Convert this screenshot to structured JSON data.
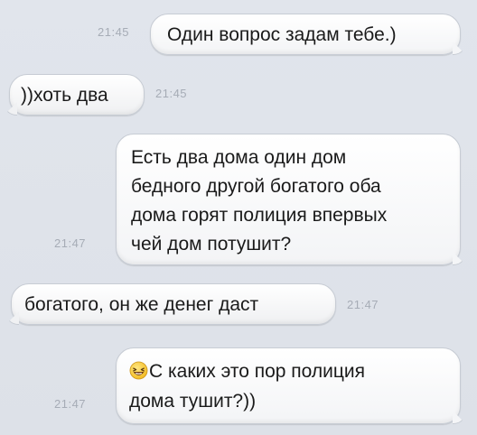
{
  "messages": [
    {
      "side": "out",
      "text": "Один вопрос задам тебе.)",
      "time": "21:45"
    },
    {
      "side": "in",
      "text": "))хоть два",
      "time": "21:45"
    },
    {
      "side": "out",
      "lines": [
        "Есть два дома один дом",
        "бедного другой богатого оба",
        "дома горят полиция впервых",
        "чей дом потушит?"
      ],
      "time": "21:47"
    },
    {
      "side": "in",
      "text": "богатого, он же денег даст",
      "time": "21:47"
    },
    {
      "side": "out",
      "emoji": "laughing-face-icon",
      "lines": [
        "С каких это пор полиция",
        "дома тушит?))"
      ],
      "time": "21:47"
    }
  ]
}
